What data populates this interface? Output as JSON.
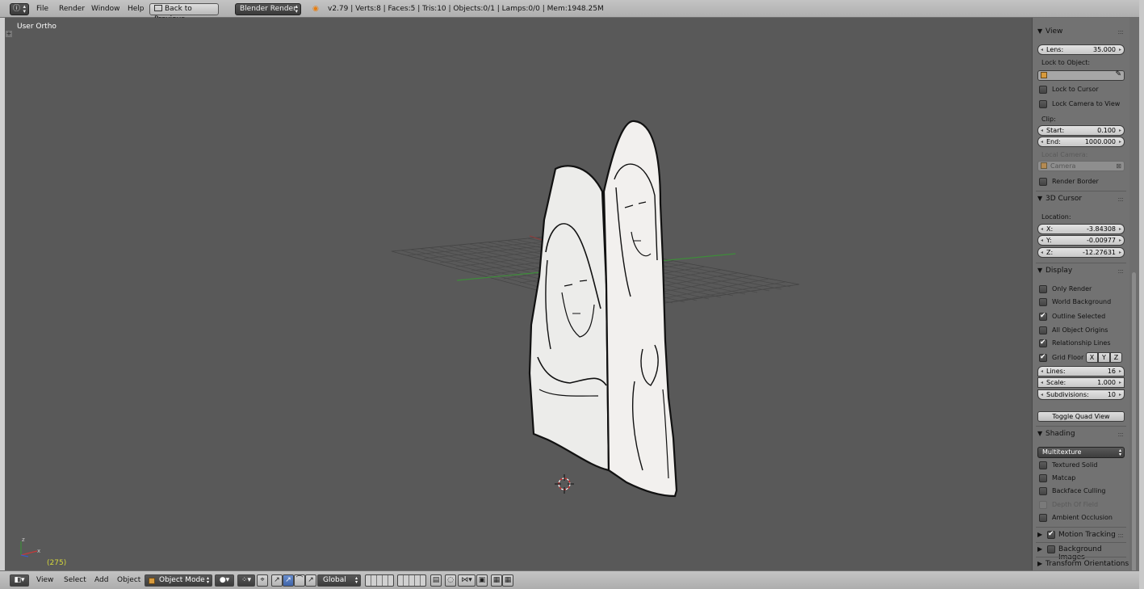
{
  "topbar": {
    "menus": [
      "File",
      "Render",
      "Window",
      "Help"
    ],
    "back_button": "Back to Previous",
    "render_engine": "Blender Render",
    "stats": "v2.79 | Verts:8 | Faces:5 | Tris:10 | Objects:0/1 | Lamps:0/0 | Mem:1948.25M"
  },
  "viewport": {
    "label": "User Ortho",
    "frame": "(275)"
  },
  "panel": {
    "view": {
      "title": "View",
      "lens_label": "Lens:",
      "lens_value": "35.000",
      "lock_to_object": "Lock to Object:",
      "lock_to_cursor": "Lock to Cursor",
      "lock_camera_to_view": "Lock Camera to View",
      "clip": "Clip:",
      "start_label": "Start:",
      "start_value": "0.100",
      "end_label": "End:",
      "end_value": "1000.000",
      "local_camera": "Local Camera:",
      "camera_value": "Camera",
      "render_border": "Render Border"
    },
    "cursor": {
      "title": "3D Cursor",
      "location": "Location:",
      "x_label": "X:",
      "x_value": "-3.84308",
      "y_label": "Y:",
      "y_value": "-0.00977",
      "z_label": "Z:",
      "z_value": "-12.27631"
    },
    "display": {
      "title": "Display",
      "only_render": "Only Render",
      "world_background": "World Background",
      "outline_selected": "Outline Selected",
      "all_object_origins": "All Object Origins",
      "relationship_lines": "Relationship Lines",
      "grid_floor": "Grid Floor",
      "axis_x": "X",
      "axis_y": "Y",
      "axis_z": "Z",
      "lines_label": "Lines:",
      "lines_value": "16",
      "scale_label": "Scale:",
      "scale_value": "1.000",
      "subdivisions_label": "Subdivisions:",
      "subdivisions_value": "10",
      "toggle_quad_view": "Toggle Quad View"
    },
    "shading": {
      "title": "Shading",
      "mode": "Multitexture",
      "textured_solid": "Textured Solid",
      "matcap": "Matcap",
      "backface_culling": "Backface Culling",
      "depth_of_field": "Depth Of Field",
      "ambient_occlusion": "Ambient Occlusion"
    },
    "motion_tracking": "Motion Tracking",
    "background_images": "Background Images",
    "transform_orientations": "Transform Orientations"
  },
  "bottombar": {
    "menus": [
      "View",
      "Select",
      "Add",
      "Object"
    ],
    "mode": "Object Mode",
    "orientation": "Global"
  },
  "colors": {
    "viewport_bg": "#595959",
    "panel_bg": "#727272",
    "header_bg": "#b8b8b8",
    "frame_number": "#d6d83a"
  }
}
